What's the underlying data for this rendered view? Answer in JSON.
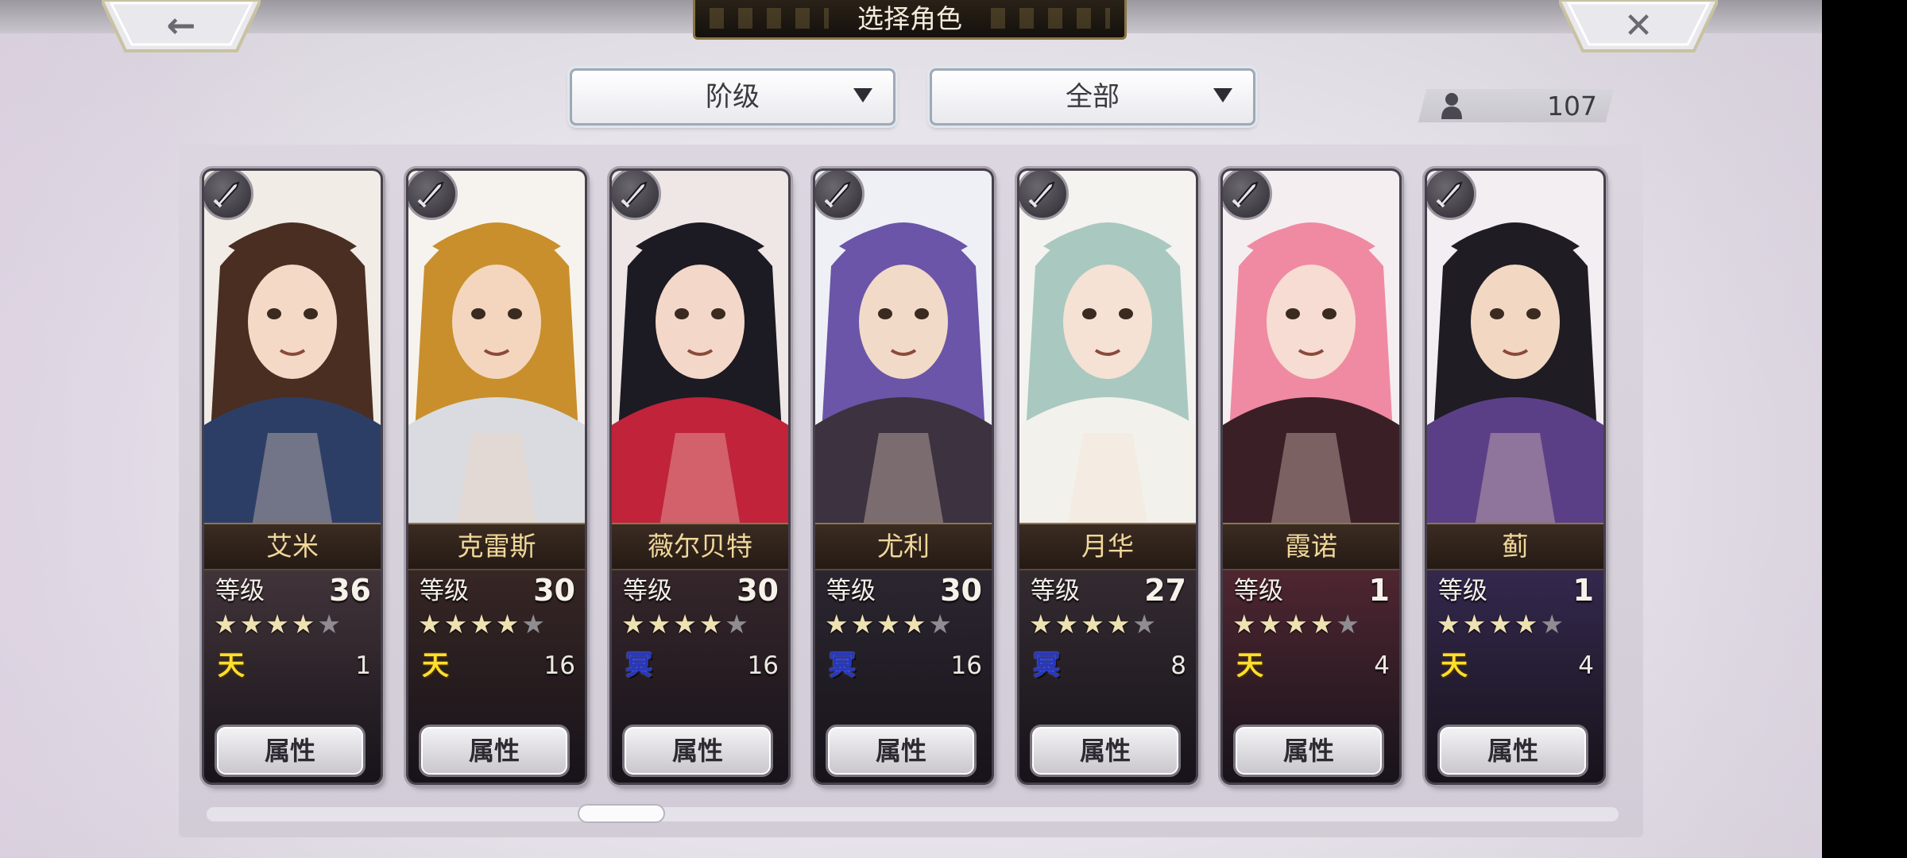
{
  "header": {
    "title": "选择角色",
    "back_icon": "back-arrow-icon",
    "close_icon": "close-icon"
  },
  "filters": {
    "rank": "阶级",
    "category": "全部"
  },
  "roster": {
    "icon": "person-icon",
    "count": "107"
  },
  "ui": {
    "level_label": "等级",
    "attribute_label": "属性",
    "heaven_symbol": "天",
    "earth_symbol": "冥"
  },
  "colors": {
    "heaven": "#ffde2e",
    "earth": "#2436c8",
    "name_text": "#f0d79a"
  },
  "characters": [
    {
      "name": "艾米",
      "level": "36",
      "stars": 4,
      "max_stars": 5,
      "element": "heaven",
      "count": "1",
      "weapon_icon": "gauntlet-icon"
    },
    {
      "name": "克雷斯",
      "level": "30",
      "stars": 4,
      "max_stars": 5,
      "element": "heaven",
      "count": "16",
      "weapon_icon": "sword-icon"
    },
    {
      "name": "薇尔贝特",
      "level": "30",
      "stars": 4,
      "max_stars": 5,
      "element": "earth",
      "count": "16",
      "weapon_icon": "sword-icon"
    },
    {
      "name": "尤利",
      "level": "30",
      "stars": 4,
      "max_stars": 5,
      "element": "earth",
      "count": "16",
      "weapon_icon": "katana-icon"
    },
    {
      "name": "月华",
      "level": "27",
      "stars": 4,
      "max_stars": 5,
      "element": "earth",
      "count": "8",
      "weapon_icon": "sword-icon"
    },
    {
      "name": "霞诺",
      "level": "1",
      "stars": 4,
      "max_stars": 5,
      "element": "heaven",
      "count": "4",
      "weapon_icon": "sword-icon"
    },
    {
      "name": "蓟",
      "level": "1",
      "stars": 4,
      "max_stars": 5,
      "element": "heaven",
      "count": "4",
      "weapon_icon": "sword-icon"
    }
  ]
}
